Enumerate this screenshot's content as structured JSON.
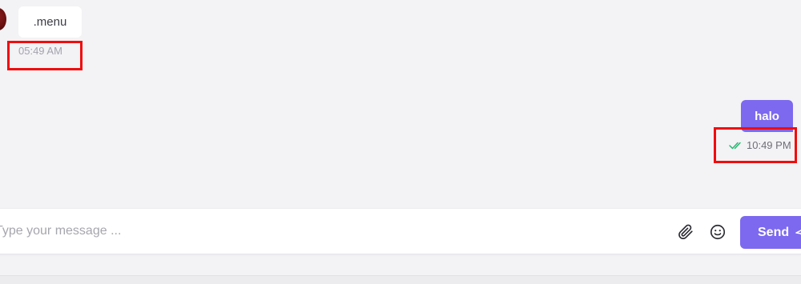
{
  "chat": {
    "messages": [
      {
        "direction": "incoming",
        "text": ".menu",
        "time": "05:49 AM",
        "avatar_color": "#7a1515"
      },
      {
        "direction": "outgoing",
        "text": "halo",
        "time": "10:49 PM",
        "status_icon": "double-check-icon",
        "status_color": "#2bb673"
      }
    ]
  },
  "composer": {
    "placeholder": "Type your message ...",
    "attach_icon": "paperclip-icon",
    "emoji_icon": "smiley-icon",
    "send_label": "Send",
    "send_icon": "paper-plane-icon"
  },
  "theme": {
    "accent": "#7c69ef",
    "background": "#f3f2f5",
    "highlight": "#f00c0c"
  }
}
